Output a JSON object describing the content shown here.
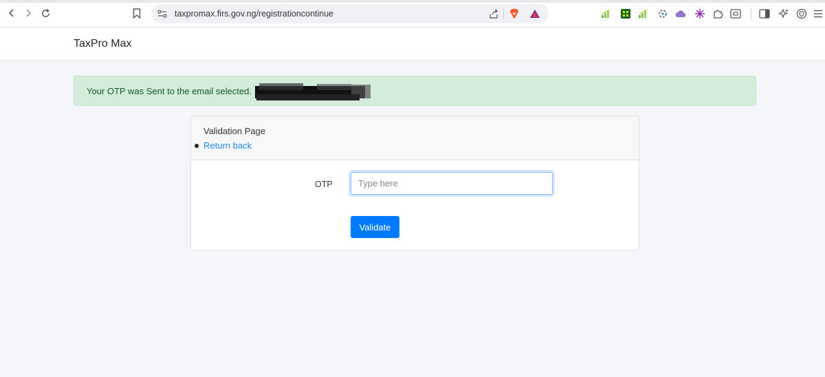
{
  "browser": {
    "url": "taxpromax.firs.gov.ng/registrationcontinue",
    "icons": {
      "back": "chevron-left-icon",
      "forward": "chevron-right-icon",
      "reload": "reload-icon",
      "bookmark": "bookmark-icon",
      "site_info": "site-settings-icon",
      "share": "share-icon",
      "brave_shield": "brave-shield-icon",
      "rewards": "brave-rewards-icon"
    },
    "colors": {
      "shield": "#fb542b",
      "rewards": "#6a1b9a"
    }
  },
  "app": {
    "brand": "TaxPro Max"
  },
  "alert": {
    "message": "Your OTP was Sent to the email selected.",
    "color": "#155724",
    "background": "#d4edda"
  },
  "card": {
    "title": "Validation Page",
    "return_link": "Return back"
  },
  "form": {
    "otp_label": "OTP",
    "otp_value": "",
    "otp_placeholder": "Type here",
    "validate_label": "Validate",
    "accent": "#007bff"
  }
}
